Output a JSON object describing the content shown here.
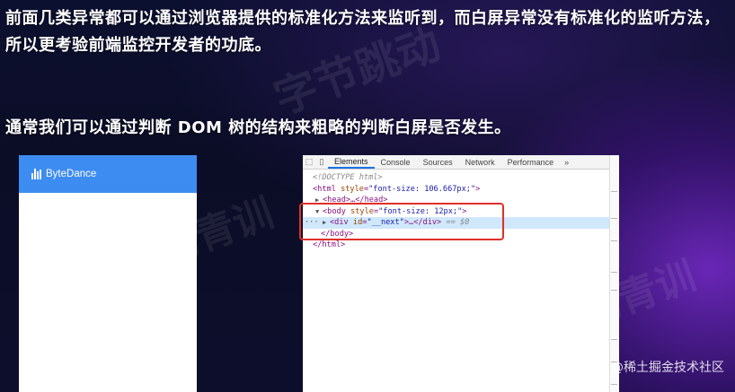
{
  "paragraphs": {
    "p1": "前面几类异常都可以通过浏览器提供的标准化方法来监听到，而白屏异常没有标准化的监听方法，所以更考验前端监控开发者的功底。",
    "p2": "通常我们可以通过判断 DOM 树的结构来粗略的判断白屏是否发生。"
  },
  "phone": {
    "brand": "ByteDance",
    "bar_color": "#3d8cf2"
  },
  "devtools": {
    "tabs": [
      "Elements",
      "Console",
      "Sources",
      "Network",
      "Performance"
    ],
    "active_tab": "Elements",
    "more": "»",
    "lines": {
      "doctype": "<!DOCTYPE html>",
      "html_open_tag": "<html",
      "html_attr": "style",
      "html_val": "\"font-size: 106.667px;\"",
      "head": "<head>…</head>",
      "body_open_tag": "<body",
      "body_attr": "style",
      "body_val": "\"font-size: 12px;\"",
      "div_tag": "<div",
      "div_attr": "id",
      "div_val": "\"__next\"",
      "div_close": ">…</div>",
      "eq": "== $0",
      "body_close": "</body>",
      "html_close": "</html>"
    },
    "highlight_color": "#e0302a"
  },
  "watermark": "@稀土掘金技术社区"
}
